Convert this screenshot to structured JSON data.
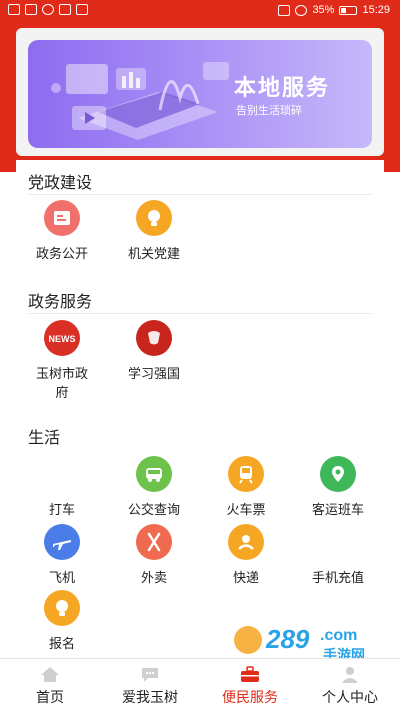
{
  "status_bar": {
    "battery": "35%",
    "time": "15:29"
  },
  "banner": {
    "title": "本地服务",
    "subtitle": "告别生活琐碎"
  },
  "sections": [
    {
      "title": "党政建设",
      "items": [
        {
          "label": "政务公开",
          "icon": "document-list-icon",
          "color": "#f2706b"
        },
        {
          "label": "机关党建",
          "icon": "lightbulb-icon",
          "color": "#f5a623"
        }
      ]
    },
    {
      "title": "政务服务",
      "items": [
        {
          "label": "玉树市政府",
          "icon": "news-icon",
          "color": "#d92f25"
        },
        {
          "label": "学习强国",
          "icon": "xuexi-icon",
          "color": "#c8251c"
        }
      ]
    },
    {
      "title": "生活",
      "items": [
        {
          "label": "打车",
          "icon": "taxi-icon",
          "color": "#ffffff"
        },
        {
          "label": "公交查询",
          "icon": "bus-icon",
          "color": "#6cc24a"
        },
        {
          "label": "火车票",
          "icon": "train-icon",
          "color": "#f5a623"
        },
        {
          "label": "客运班车",
          "icon": "map-pin-icon",
          "color": "#3fb85a"
        },
        {
          "label": "飞机",
          "icon": "airplane-icon",
          "color": "#4a7de8"
        },
        {
          "label": "外卖",
          "icon": "utensils-icon",
          "color": "#f06a4f"
        },
        {
          "label": "快递",
          "icon": "delivery-icon",
          "color": "#f5a623"
        },
        {
          "label": "手机充值",
          "icon": "phone-icon",
          "color": "#ffffff"
        },
        {
          "label": "报名",
          "icon": "lightbulb-icon",
          "color": "#f5a623"
        }
      ]
    }
  ],
  "nav": [
    {
      "label": "首页",
      "icon": "home-icon",
      "active": false
    },
    {
      "label": "爱我玉树",
      "icon": "chat-icon",
      "active": false
    },
    {
      "label": "便民服务",
      "icon": "toolbox-icon",
      "active": true
    },
    {
      "label": "个人中心",
      "icon": "user-icon",
      "active": false
    }
  ],
  "watermark": {
    "text": "289",
    "domain": ".com",
    "caption": "手游网"
  },
  "colors": {
    "brand_red": "#e02b1a",
    "banner_purple": "#8e6cf0"
  }
}
